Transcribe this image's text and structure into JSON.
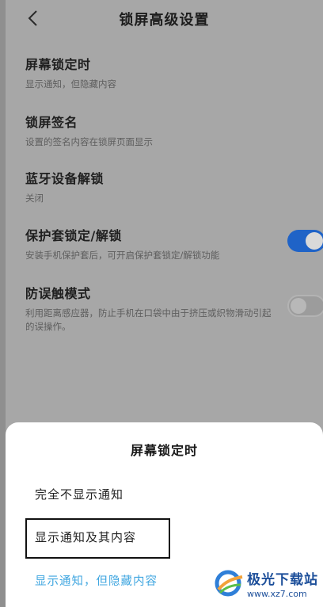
{
  "header": {
    "title": "锁屏高级设置"
  },
  "settings": [
    {
      "title": "屏幕锁定时",
      "subtitle": "显示通知，但隐藏内容"
    },
    {
      "title": "锁屏签名",
      "subtitle": "设置的签名内容在锁屏页面显示"
    },
    {
      "title": "蓝牙设备解锁",
      "subtitle": "关闭"
    },
    {
      "title": "保护套锁定/解锁",
      "subtitle": "安装手机保护套后，可开启保护套锁定/解锁功能",
      "toggle": "on"
    },
    {
      "title": "防误触模式",
      "subtitle": "利用距离感应器，防止手机在口袋中由于挤压或织物滑动引起的误操作。",
      "toggle": "off"
    }
  ],
  "sheet": {
    "title": "屏幕锁定时",
    "options": [
      "完全不显示通知",
      "显示通知及其内容",
      "显示通知，但隐藏内容"
    ],
    "selected_index": 2
  },
  "watermark": {
    "name": "极光下载站",
    "url": "www.xz7.com"
  },
  "colors": {
    "accent": "#1f63c7",
    "selected_text": "#3fa6e0"
  }
}
